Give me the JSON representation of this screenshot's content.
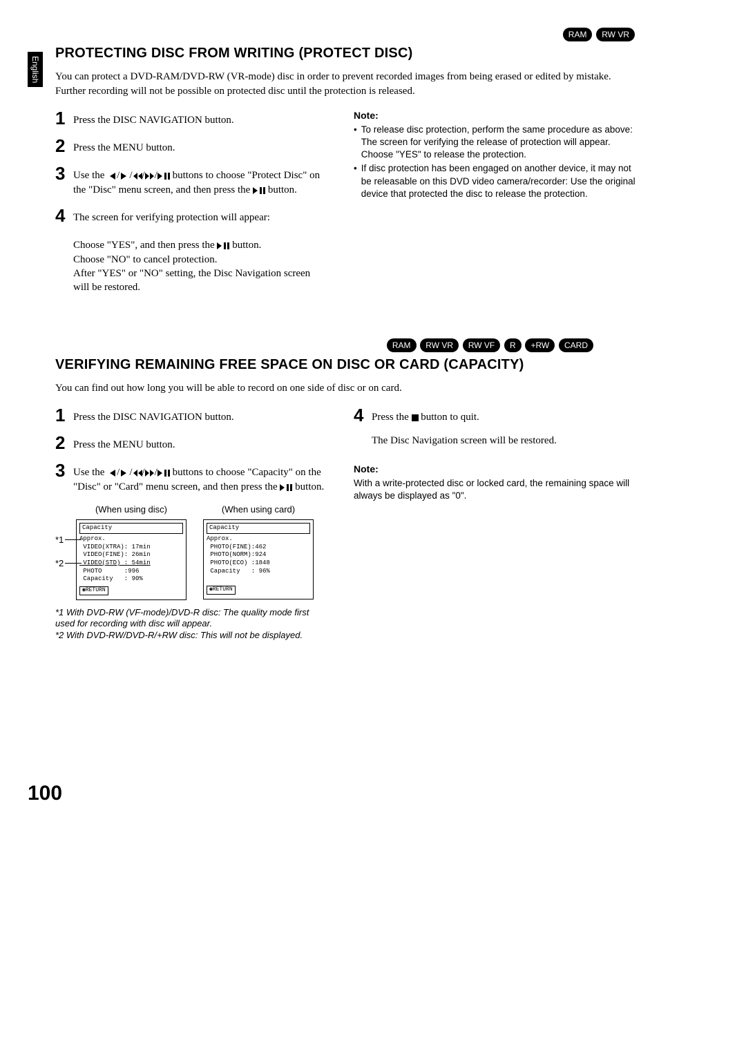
{
  "side_tab": "English",
  "section1": {
    "badges": [
      "RAM",
      "RW VR"
    ],
    "title": "PROTECTING DISC FROM WRITING (PROTECT DISC)",
    "intro": "You can protect a DVD-RAM/DVD-RW (VR-mode) disc in order to prevent recorded images from being erased or edited by mistake. Further recording will not be possible on protected disc until the protection is released.",
    "steps": {
      "s1": "Press the DISC NAVIGATION button.",
      "s2": "Press the MENU button.",
      "s3a": "Use the ",
      "s3b": " buttons to choose \"Protect Disc\" on the \"Disc\" menu screen, and then press the ",
      "s3c": " button.",
      "s4a": "The screen for verifying protection will appear:",
      "s4b": "Choose \"YES\", and then press the ",
      "s4c": " button.",
      "s4d": "Choose \"NO\" to cancel protection.",
      "s4e": "After \"YES\" or \"NO\" setting, the Disc Navigation screen will be restored."
    },
    "note_head": "Note:",
    "notes": [
      "To release disc protection, perform the same procedure as above: The screen for verifying the release of protection will appear. Choose \"YES\" to release the protection.",
      "If disc protection has been engaged on another device, it may not be releasable on this DVD video camera/recorder: Use the original device that protected the disc to release the protection."
    ]
  },
  "section2": {
    "badges": [
      "RAM",
      "RW VR",
      "RW VF",
      "R",
      "+RW",
      "CARD"
    ],
    "title": "VERIFYING REMAINING FREE SPACE ON DISC OR CARD (CAPACITY)",
    "intro": "You can find out how long you will be able to record on one side of disc or on card.",
    "steps": {
      "s1": "Press the DISC NAVIGATION button.",
      "s2": "Press the MENU button.",
      "s3a": "Use the ",
      "s3b": " buttons to choose \"Capacity\" on the \"Disc\" or \"Card\" menu screen, and then press the ",
      "s3c": " button.",
      "s4a": "Press the ",
      "s4b": " button to quit.",
      "s4c": "The Disc Navigation screen will be restored."
    },
    "fig_disc_label": "(When using disc)",
    "fig_card_label": "(When using card)",
    "ann1": "*1",
    "ann2": "*2",
    "panel_disc": {
      "title": "Capacity",
      "approx": "Approx.",
      "r1": " VIDEO(XTRA): 17min",
      "r2": " VIDEO(FINE): 26min",
      "r3": " VIDEO(STD) : 54min",
      "r4": " PHOTO      :996",
      "r5": " Capacity   : 90%",
      "ret": "RETURN"
    },
    "panel_card": {
      "title": "Capacity",
      "approx": "Approx.",
      "r1": " PHOTO(FINE):462",
      "r2": " PHOTO(NORM):924",
      "r3": " PHOTO(ECO) :1848",
      "r4": " Capacity   : 96%",
      "ret": "RETURN"
    },
    "foot1": "*1 With DVD-RW (VF-mode)/DVD-R disc: The quality mode first used for recording with disc will appear.",
    "foot2": "*2 With DVD-RW/DVD-R/+RW disc: This will not be displayed.",
    "note_head": "Note:",
    "note_text": "With a write-protected disc or locked card, the remaining space will always be displayed as \"0\"."
  },
  "page_number": "100"
}
